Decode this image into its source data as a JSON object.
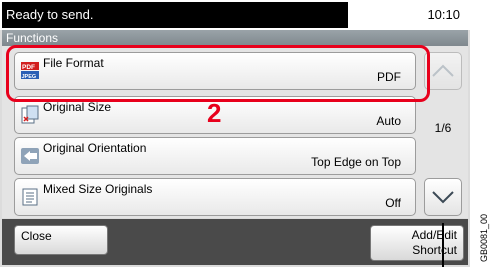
{
  "status": {
    "message": "Ready to send.",
    "time": "10:10"
  },
  "title": "Functions",
  "rows": [
    {
      "label": "File Format",
      "value": "PDF",
      "icon": "pdf-jpeg-file-icon"
    },
    {
      "label": "Original Size",
      "value": "Auto",
      "icon": "original-size-icon"
    },
    {
      "label": "Original Orientation",
      "value": "Top Edge on Top",
      "icon": "orientation-icon"
    },
    {
      "label": "Mixed Size Originals",
      "value": "Off",
      "icon": "mixed-size-icon"
    }
  ],
  "page_indicator": "1/6",
  "callout_number": "2",
  "buttons": {
    "close": "Close",
    "addedit_line1": "Add/Edit",
    "addedit_line2": "Shortcut"
  },
  "figure_code": "GB0081_00",
  "icon_labels": {
    "pdf": "PDF",
    "jpeg": "JPEG"
  },
  "colors": {
    "highlight": "#e8001c",
    "statusbar": "#000000"
  }
}
